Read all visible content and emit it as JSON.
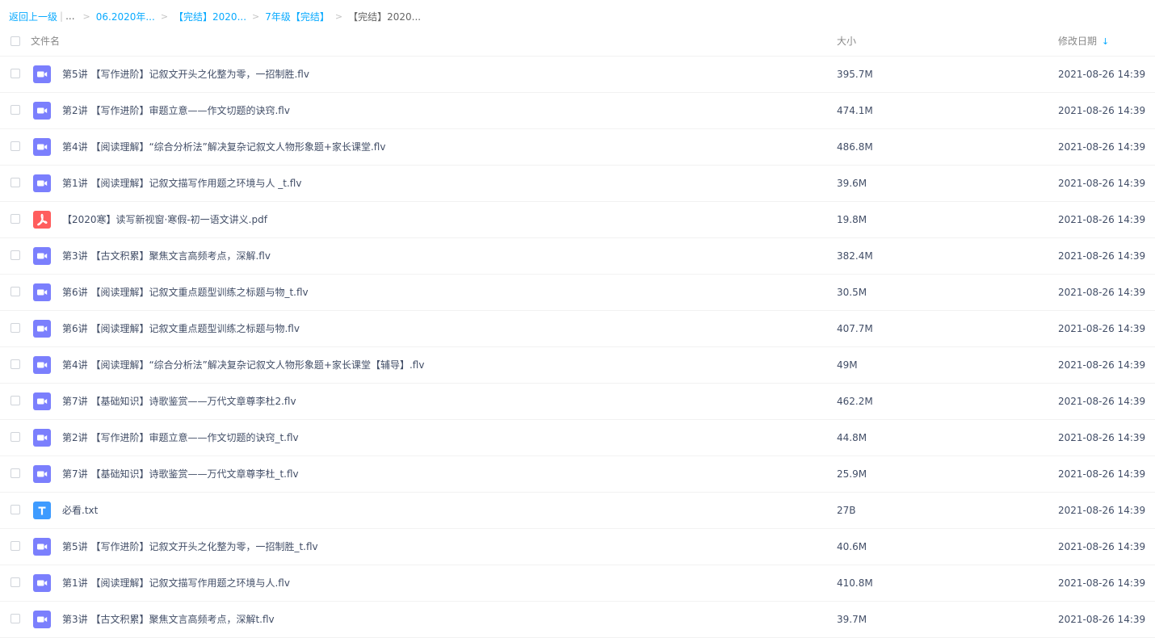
{
  "breadcrumb": {
    "back": "返回上一级",
    "bar": "|",
    "ellipsis": "...",
    "sep": ">",
    "items": [
      "06.2020年...",
      "【完结】2020...",
      "7年级【完结】"
    ],
    "current": "【完结】2020..."
  },
  "header": {
    "name": "文件名",
    "size": "大小",
    "date": "修改日期",
    "sort_glyph": "↓"
  },
  "colors": {
    "accent": "#09aaff",
    "video_icon": "#7b7ffd",
    "pdf_icon": "#ff5d5d",
    "txt_icon": "#3e9bff"
  },
  "files": [
    {
      "name": "第5讲 【写作进阶】记叙文开头之化整为零，一招制胜.flv",
      "size": "395.7M",
      "date": "2021-08-26 14:39",
      "icon": "video-icon"
    },
    {
      "name": "第2讲 【写作进阶】审题立意——作文切题的诀窍.flv",
      "size": "474.1M",
      "date": "2021-08-26 14:39",
      "icon": "video-icon"
    },
    {
      "name": "第4讲 【阅读理解】“综合分析法”解决复杂记叙文人物形象题+家长课堂.flv",
      "size": "486.8M",
      "date": "2021-08-26 14:39",
      "icon": "video-icon"
    },
    {
      "name": "第1讲 【阅读理解】记叙文描写作用题之环境与人 _t.flv",
      "size": "39.6M",
      "date": "2021-08-26 14:39",
      "icon": "video-icon"
    },
    {
      "name": "【2020寒】读写新视窗·寒假-初一语文讲义.pdf",
      "size": "19.8M",
      "date": "2021-08-26 14:39",
      "icon": "pdf-icon"
    },
    {
      "name": "第3讲 【古文积累】聚焦文言高频考点，深解.flv",
      "size": "382.4M",
      "date": "2021-08-26 14:39",
      "icon": "video-icon"
    },
    {
      "name": "第6讲 【阅读理解】记叙文重点题型训练之标题与物_t.flv",
      "size": "30.5M",
      "date": "2021-08-26 14:39",
      "icon": "video-icon"
    },
    {
      "name": "第6讲 【阅读理解】记叙文重点题型训练之标题与物.flv",
      "size": "407.7M",
      "date": "2021-08-26 14:39",
      "icon": "video-icon"
    },
    {
      "name": "第4讲 【阅读理解】“综合分析法”解决复杂记叙文人物形象题+家长课堂【辅导】.flv",
      "size": "49M",
      "date": "2021-08-26 14:39",
      "icon": "video-icon"
    },
    {
      "name": "第7讲 【基础知识】诗歌鉴赏——万代文章尊李杜2.flv",
      "size": "462.2M",
      "date": "2021-08-26 14:39",
      "icon": "video-icon"
    },
    {
      "name": "第2讲 【写作进阶】审题立意——作文切题的诀窍_t.flv",
      "size": "44.8M",
      "date": "2021-08-26 14:39",
      "icon": "video-icon"
    },
    {
      "name": "第7讲 【基础知识】诗歌鉴赏——万代文章尊李杜_t.flv",
      "size": "25.9M",
      "date": "2021-08-26 14:39",
      "icon": "video-icon"
    },
    {
      "name": "必看.txt",
      "size": "27B",
      "date": "2021-08-26 14:39",
      "icon": "txt-icon"
    },
    {
      "name": "第5讲 【写作进阶】记叙文开头之化整为零，一招制胜_t.flv",
      "size": "40.6M",
      "date": "2021-08-26 14:39",
      "icon": "video-icon"
    },
    {
      "name": "第1讲 【阅读理解】记叙文描写作用题之环境与人.flv",
      "size": "410.8M",
      "date": "2021-08-26 14:39",
      "icon": "video-icon"
    },
    {
      "name": "第3讲 【古文积累】聚焦文言高频考点，深解t.flv",
      "size": "39.7M",
      "date": "2021-08-26 14:39",
      "icon": "video-icon"
    }
  ]
}
